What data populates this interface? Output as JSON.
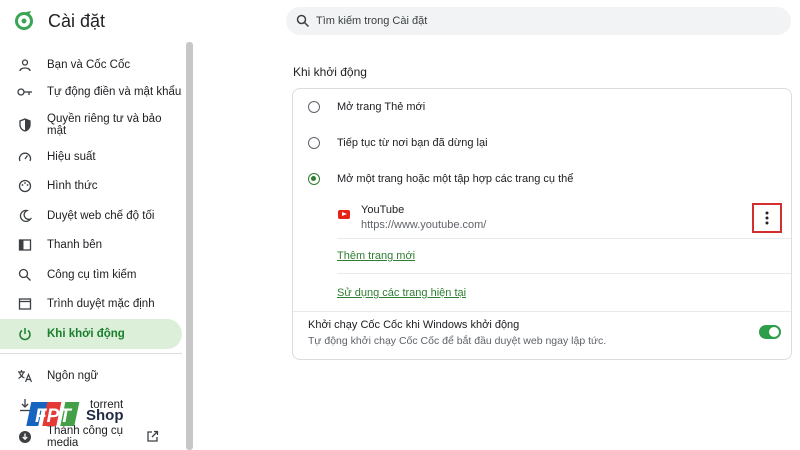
{
  "header": {
    "title": "Cài đặt",
    "search_placeholder": "Tìm kiếm trong Cài đặt"
  },
  "sidebar": {
    "items": [
      {
        "label": "Bạn và Cốc Cốc",
        "icon": "person-icon"
      },
      {
        "label": "Tự động điền và mật khẩu",
        "icon": "key-icon"
      },
      {
        "label": "Quyền riêng tư và bảo mật",
        "icon": "shield-icon"
      },
      {
        "label": "Hiệu suất",
        "icon": "speedometer-icon"
      },
      {
        "label": "Hình thức",
        "icon": "palette-icon"
      },
      {
        "label": "Duyệt web chế độ tối",
        "icon": "moon-icon"
      },
      {
        "label": "Thanh bên",
        "icon": "sidebar-icon"
      },
      {
        "label": "Công cụ tìm kiếm",
        "icon": "search-icon"
      },
      {
        "label": "Trình duyệt mặc định",
        "icon": "browser-icon"
      },
      {
        "label": "Khi khởi động",
        "icon": "power-icon",
        "active": true
      },
      {
        "label": "Ngôn ngữ",
        "icon": "translate-icon"
      },
      {
        "label": "torrent",
        "icon": "download-icon"
      },
      {
        "label": "Thành công cụ media",
        "icon": "download-circle-icon"
      }
    ]
  },
  "watermark": {
    "brand": "FPT",
    "shop": "Shop"
  },
  "startup": {
    "section_title": "Khi khởi động",
    "options": [
      {
        "label": "Mở trang Thẻ mới",
        "checked": false
      },
      {
        "label": "Tiếp tục từ nơi bạn đã dừng lại",
        "checked": false
      },
      {
        "label": "Mở một trang hoặc một tập hợp các trang cụ thể",
        "checked": true
      }
    ],
    "pages": [
      {
        "name": "YouTube",
        "url": "https://www.youtube.com/"
      }
    ],
    "add_page_link": "Thêm trang mới",
    "use_current_link": "Sử dụng các trang hiện tại",
    "launch_title": "Khởi chạy Cốc Cốc khi Windows khởi động",
    "launch_desc": "Tự động khởi chạy Cốc Cốc để bắt đầu duyệt web ngay lập tức.",
    "launch_enabled": true
  },
  "colors": {
    "accent": "#2e7d32",
    "active_bg": "#dcefd8",
    "highlight_box": "#d32f2f",
    "youtube_red": "#e62117"
  }
}
